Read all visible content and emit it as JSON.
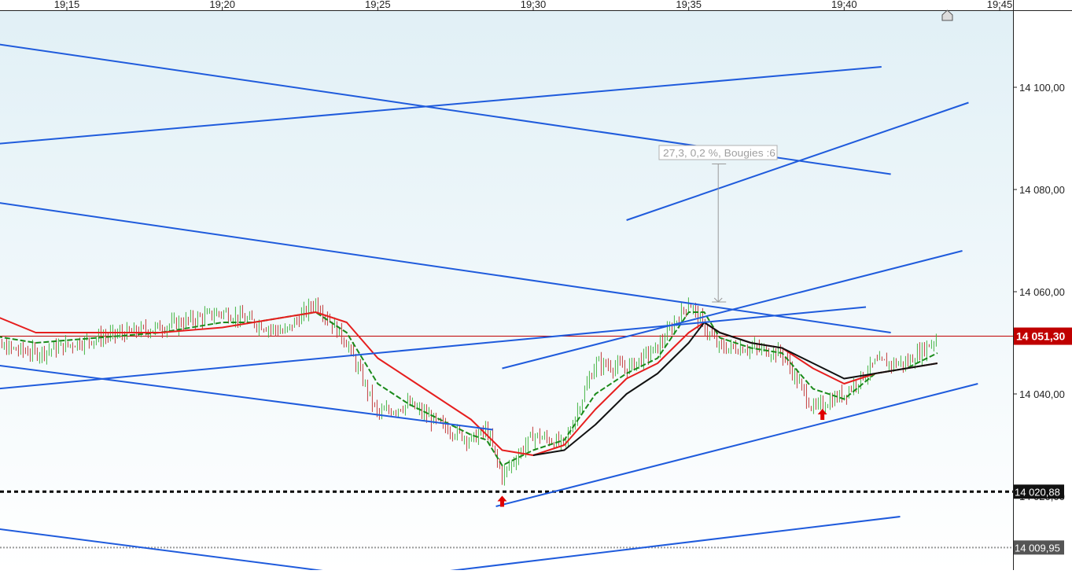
{
  "chart_data": {
    "type": "line",
    "title": "",
    "subtitle": "",
    "xlabel": "",
    "ylabel": "",
    "x_axis": {
      "ticks": [
        "19:15",
        "19:20",
        "19:25",
        "19:30",
        "19:35",
        "19:40",
        "19:45"
      ]
    },
    "y_axis": {
      "ticks": [
        {
          "value": 14100.0,
          "label": "14 100,00"
        },
        {
          "value": 14080.0,
          "label": "14 080,00"
        },
        {
          "value": 14060.0,
          "label": "14 060,00"
        },
        {
          "value": 14040.0,
          "label": "14 040,00"
        },
        {
          "value": 14020.0,
          "label": "14 020,00"
        }
      ],
      "ylim": [
        14005.0,
        14115.0
      ]
    },
    "grid": false,
    "legend": "none",
    "colors": {
      "background_top": "#e1f0f6",
      "background_bottom": "#ffffff",
      "trendline": "#1f5bdc",
      "price_up": "#46b546",
      "price_down": "#c23b3b",
      "ma_fast": "#1a8a1a",
      "ma_mid": "#e61e1e",
      "ma_slow": "#111111",
      "current_price_badge": "#c00000",
      "level_badge": "#111111",
      "level_low_badge": "#555555"
    },
    "price_series": {
      "name": "",
      "x": [
        "19:12",
        "19:14",
        "19:16",
        "19:18",
        "19:20",
        "19:21",
        "19:22",
        "19:23",
        "19:24",
        "19:25",
        "19:26",
        "19:27",
        "19:28",
        "19:28.5",
        "19:29",
        "19:30",
        "19:31",
        "19:32",
        "19:33",
        "19:34",
        "19:35",
        "19:35.5",
        "19:36",
        "19:37",
        "19:38",
        "19:39",
        "19:40",
        "19:41",
        "19:42",
        "19:43"
      ],
      "y": [
        14050,
        14048,
        14051,
        14053,
        14056,
        14054,
        14052,
        14058,
        14050,
        14036,
        14038,
        14034,
        14031,
        14033,
        14024,
        14032,
        14030,
        14046,
        14045,
        14049,
        14058,
        14053,
        14049,
        14049,
        14048,
        14037,
        14040,
        14046,
        14046,
        14051
      ]
    },
    "moving_averages": [
      {
        "name": "",
        "y": [
          14052,
          14050,
          14051,
          14052,
          14054,
          14054,
          14055,
          14056,
          14052,
          14042,
          14038,
          14035,
          14032,
          14031,
          14026,
          14029,
          14031,
          14040,
          14044,
          14047,
          14056,
          14056,
          14051,
          14049,
          14048,
          14041,
          14039,
          14044,
          14045,
          14048
        ]
      },
      {
        "name": "",
        "y": [
          14057,
          14052,
          14052,
          14052,
          14053,
          14054,
          14055,
          14056,
          14054,
          14047,
          14043,
          14039,
          14035,
          14032,
          14029,
          14028,
          14030,
          14037,
          14043,
          14046,
          14052,
          14054,
          14052,
          14050,
          14049,
          14045,
          14042,
          14044,
          14045,
          14046
        ]
      },
      {
        "name": "",
        "y": [
          null,
          null,
          null,
          null,
          null,
          null,
          null,
          null,
          null,
          null,
          null,
          null,
          null,
          null,
          null,
          14028,
          14029,
          14034,
          14040,
          14044,
          14050,
          14054,
          14052,
          14050,
          14049,
          14046,
          14043,
          14044,
          14045,
          14046
        ]
      }
    ],
    "trendlines": [
      {
        "from": {
          "x": "19:11",
          "y": 14110
        },
        "to": {
          "x": "19:41.5",
          "y": 14083
        }
      },
      {
        "from": {
          "x": "19:11",
          "y": 14088
        },
        "to": {
          "x": "19:41.2",
          "y": 14104
        }
      },
      {
        "from": {
          "x": "19:11",
          "y": 14079
        },
        "to": {
          "x": "19:41.5",
          "y": 14052
        }
      },
      {
        "from": {
          "x": "19:11",
          "y": 14047
        },
        "to": {
          "x": "19:28.7",
          "y": 14033
        }
      },
      {
        "from": {
          "x": "19:11",
          "y": 14040
        },
        "to": {
          "x": "19:40.7",
          "y": 14057
        }
      },
      {
        "from": {
          "x": "19:33",
          "y": 14074
        },
        "to": {
          "x": "19:44",
          "y": 14097
        }
      },
      {
        "from": {
          "x": "19:29",
          "y": 14045
        },
        "to": {
          "x": "19:43.8",
          "y": 14068
        }
      },
      {
        "from": {
          "x": "19:28.8",
          "y": 14018
        },
        "to": {
          "x": "19:44.3",
          "y": 14042
        }
      },
      {
        "from": {
          "x": "19:11",
          "y": 14015
        },
        "to": {
          "x": "19:25",
          "y": 14004
        }
      },
      {
        "from": {
          "x": "19:26.8",
          "y": 14005
        },
        "to": {
          "x": "19:41.8",
          "y": 14016
        }
      }
    ],
    "horizontal_levels": [
      {
        "value": 14051.3,
        "label": "14 051,30"
      },
      {
        "value": 14020.88,
        "label": "14 020,88"
      },
      {
        "value": 14009.95,
        "label": "14 009,95"
      }
    ],
    "measure_annotation": {
      "label": "27,3, 0,2 %, Bougies :6",
      "x": "19:36",
      "from_y": 14058.0,
      "to_y": 14085.0
    },
    "markers": [
      {
        "type": "arrow-up",
        "x": "19:29",
        "y": 14019
      },
      {
        "type": "arrow-up",
        "x": "19:39.3",
        "y": 14036
      }
    ]
  }
}
